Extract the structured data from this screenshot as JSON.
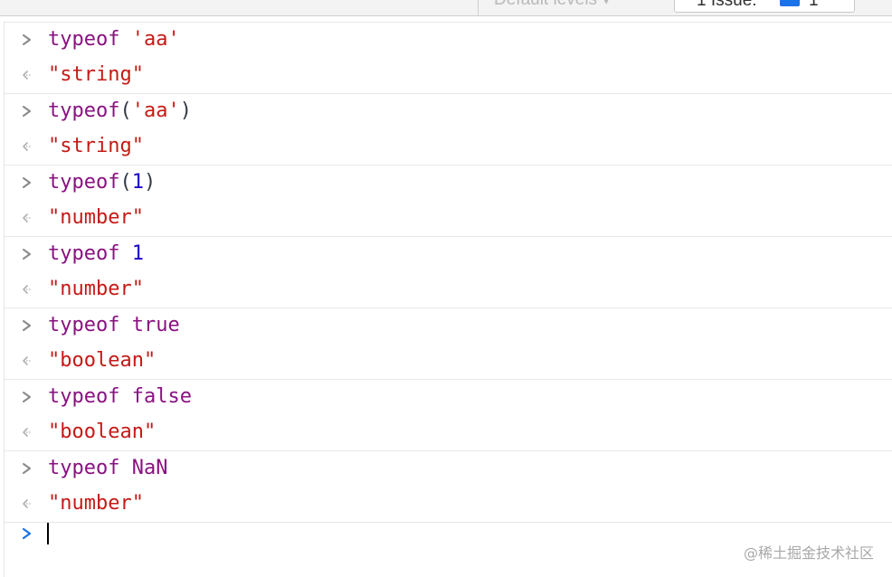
{
  "toolbar": {
    "levels_label": "Default levels ▾",
    "issues_label": "1 Issue:",
    "issues_count": "1"
  },
  "console": {
    "entries": [
      {
        "tokens": [
          {
            "t": "typeof",
            "c": "kw"
          },
          {
            "t": " ",
            "c": "punc"
          },
          {
            "t": "'aa'",
            "c": "str"
          }
        ],
        "result": "\"string\""
      },
      {
        "tokens": [
          {
            "t": "typeof",
            "c": "kw"
          },
          {
            "t": "(",
            "c": "punc"
          },
          {
            "t": "'aa'",
            "c": "str"
          },
          {
            "t": ")",
            "c": "punc"
          }
        ],
        "result": "\"string\""
      },
      {
        "tokens": [
          {
            "t": "typeof",
            "c": "kw"
          },
          {
            "t": "(",
            "c": "punc"
          },
          {
            "t": "1",
            "c": "num"
          },
          {
            "t": ")",
            "c": "punc"
          }
        ],
        "result": "\"number\""
      },
      {
        "tokens": [
          {
            "t": "typeof",
            "c": "kw"
          },
          {
            "t": " ",
            "c": "punc"
          },
          {
            "t": "1",
            "c": "num"
          }
        ],
        "result": "\"number\""
      },
      {
        "tokens": [
          {
            "t": "typeof",
            "c": "kw"
          },
          {
            "t": " ",
            "c": "punc"
          },
          {
            "t": "true",
            "c": "kw"
          }
        ],
        "result": "\"boolean\""
      },
      {
        "tokens": [
          {
            "t": "typeof",
            "c": "kw"
          },
          {
            "t": " ",
            "c": "punc"
          },
          {
            "t": "false",
            "c": "kw"
          }
        ],
        "result": "\"boolean\""
      },
      {
        "tokens": [
          {
            "t": "typeof",
            "c": "kw"
          },
          {
            "t": " ",
            "c": "punc"
          },
          {
            "t": "NaN",
            "c": "kw"
          }
        ],
        "result": "\"number\""
      }
    ],
    "input_value": ""
  },
  "colors": {
    "keyword": "#881280",
    "string": "#c41a16",
    "number": "#1c00cf",
    "prompt_active": "#1a73e8",
    "prompt_history": "#9a9a9a"
  },
  "icons": {
    "input_prompt": "chevron-right-icon",
    "result_marker": "return-arrow-icon",
    "issues": "chat-bubble-icon"
  },
  "watermark": "@稀土掘金技术社区"
}
